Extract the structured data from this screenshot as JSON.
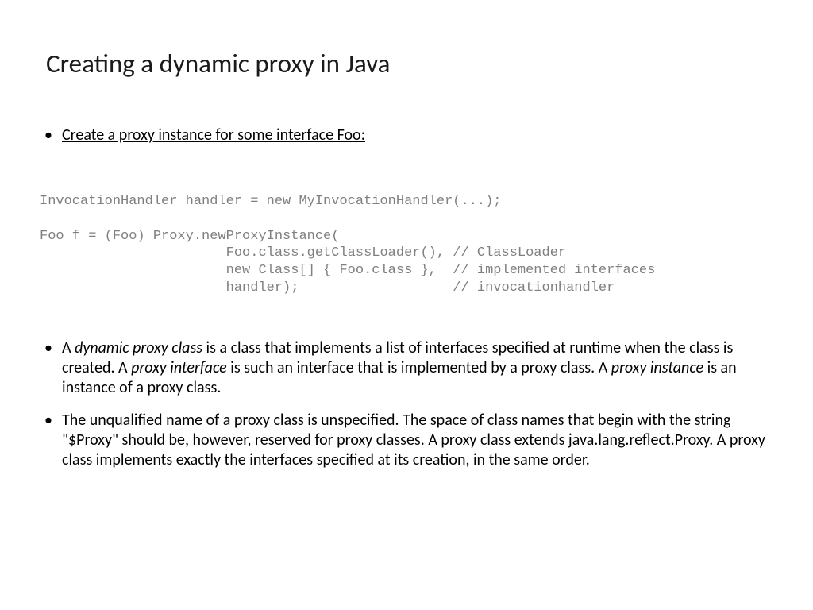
{
  "title": "Creating a dynamic proxy in Java",
  "bullet1": "Create a proxy instance for some interface  Foo:",
  "code": "InvocationHandler handler = new MyInvocationHandler(...);\n\nFoo f = (Foo) Proxy.newProxyInstance(\n                       Foo.class.getClassLoader(), // ClassLoader\n                       new Class[] { Foo.class },  // implemented interfaces\n                       handler);                   // invocationhandler",
  "p2a": "A ",
  "p2b": "dynamic proxy class",
  "p2c": "  is a class that implements a list of interfaces specified at runtime when the class is created. A ",
  "p2d": "proxy interface",
  "p2e": " is such an interface that is implemented by a proxy class. A ",
  "p2f": "proxy instance",
  "p2g": " is an instance of a proxy class.",
  "p3": "The unqualified name of a proxy class is unspecified. The space of class names that begin with the string \"$Proxy\" should be, however, reserved for proxy classes. A proxy class extends java.lang.reflect.Proxy. A proxy class implements exactly the interfaces specified at its creation, in the same order."
}
